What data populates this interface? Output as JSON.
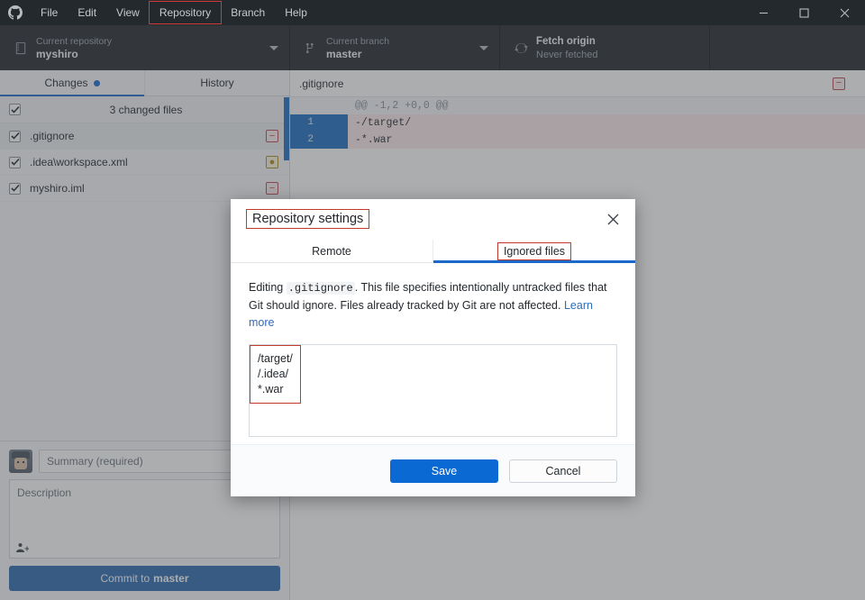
{
  "titlebar": {
    "logo_icon": "github-logo-icon",
    "menu": [
      {
        "label": "File",
        "highlight": false
      },
      {
        "label": "Edit",
        "highlight": false
      },
      {
        "label": "View",
        "highlight": false
      },
      {
        "label": "Repository",
        "highlight": true
      },
      {
        "label": "Branch",
        "highlight": false
      },
      {
        "label": "Help",
        "highlight": false
      }
    ],
    "window_controls": [
      "minimize-icon",
      "maximize-icon",
      "close-icon"
    ]
  },
  "toolbar": {
    "repository": {
      "label": "Current repository",
      "value": "myshiro",
      "icon": "repo-book-icon"
    },
    "branch": {
      "label": "Current branch",
      "value": "master",
      "icon": "branch-icon"
    },
    "fetch": {
      "title": "Fetch origin",
      "subtitle": "Never fetched",
      "icon": "sync-refresh-icon"
    }
  },
  "sidebar": {
    "tabs": [
      {
        "label": "Changes",
        "active": true,
        "dot": true
      },
      {
        "label": "History",
        "active": false,
        "dot": false
      }
    ],
    "summary_row": {
      "label": "3 changed files",
      "checked": true
    },
    "files": [
      {
        "name": ".gitignore",
        "status": "deleted",
        "status_glyph": "−",
        "checked": true,
        "selected": true
      },
      {
        "name": ".idea\\workspace.xml",
        "status": "modified",
        "status_glyph": "●",
        "checked": true,
        "selected": false
      },
      {
        "name": "myshiro.iml",
        "status": "deleted",
        "status_glyph": "−",
        "checked": true,
        "selected": false
      }
    ],
    "commit": {
      "summary_placeholder": "Summary (required)",
      "description_placeholder": "Description",
      "coauthor_icon": "add-person-icon",
      "button_prefix": "Commit to",
      "button_branch": "master"
    }
  },
  "diff": {
    "filename": ".gitignore",
    "status_glyph": "−",
    "status": "deleted",
    "lines": [
      {
        "old": "",
        "new": "",
        "text": "@@ -1,2 +0,0 @@",
        "kind": "hunk"
      },
      {
        "old": "1",
        "new": "",
        "text": "-/target/",
        "kind": "del"
      },
      {
        "old": "2",
        "new": "",
        "text": "-*.war",
        "kind": "del"
      }
    ]
  },
  "modal": {
    "title": "Repository settings",
    "title_boxed": true,
    "close_icon": "close-icon",
    "tabs": [
      {
        "label": "Remote",
        "active": false,
        "boxed": false
      },
      {
        "label": "Ignored files",
        "active": true,
        "boxed": true
      }
    ],
    "description": {
      "lead": "Editing",
      "code": ".gitignore",
      "rest": ". This file specifies intentionally untracked files that Git should ignore. Files already tracked by Git are not affected.",
      "link": "Learn more"
    },
    "textarea_value": "/target/\n/.idea/\n*.war",
    "textarea_boxed": true,
    "buttons": {
      "save": "Save",
      "cancel": "Cancel"
    }
  },
  "colors": {
    "accent_blue": "#1b6ac9",
    "primary_button": "#0b69d4",
    "annotation_red": "#c0392b",
    "titlebar_bg": "#24292e",
    "deleted_bg": "#fbeaec",
    "selected_gutter": "#1d6fc4"
  }
}
